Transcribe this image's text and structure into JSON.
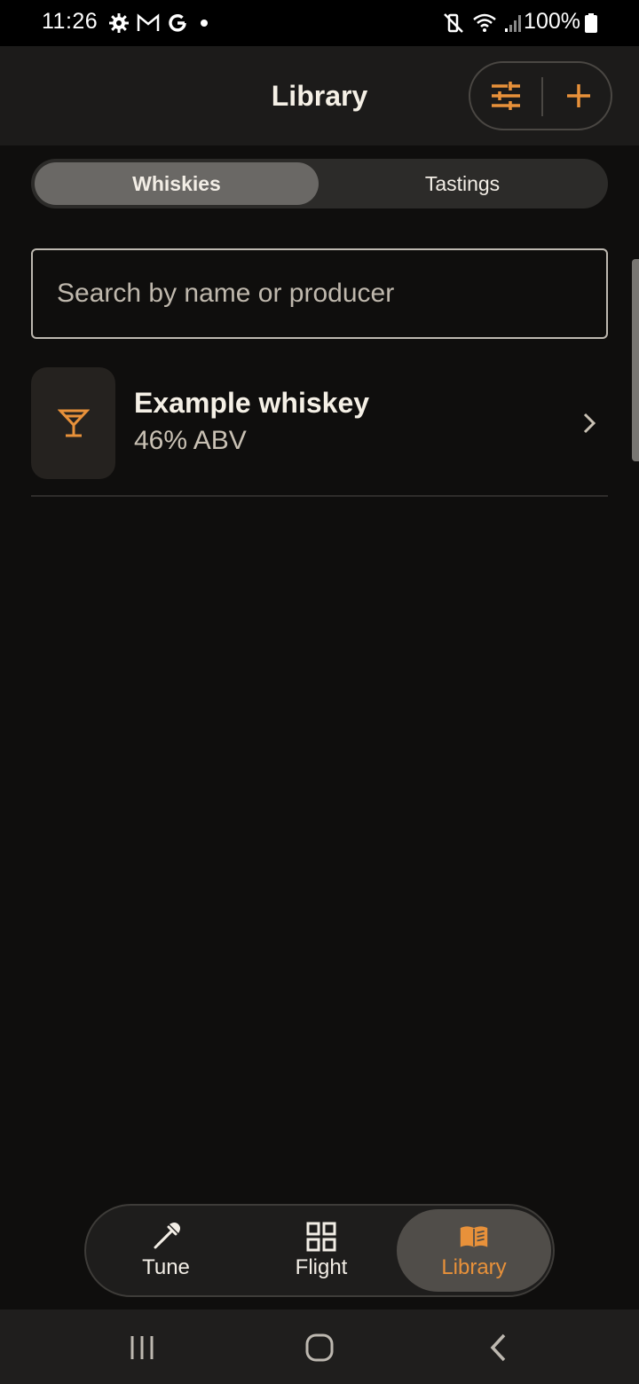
{
  "status_bar": {
    "time": "11:26",
    "battery": "100%",
    "left_icons": [
      "settings-icon",
      "gmail-icon",
      "google-icon",
      "dot-icon"
    ],
    "right_icons": [
      "mute-icon",
      "wifi-icon",
      "signal-icon",
      "battery-icon"
    ]
  },
  "header": {
    "title": "Library",
    "actions": [
      "filter-icon",
      "add-icon"
    ]
  },
  "tabs": [
    {
      "label": "Whiskies",
      "active": true
    },
    {
      "label": "Tastings",
      "active": false
    }
  ],
  "search": {
    "placeholder": "Search by name or producer",
    "value": ""
  },
  "items": [
    {
      "title": "Example whiskey",
      "subtitle": "46% ABV",
      "icon": "cocktail-icon"
    }
  ],
  "bottom_nav": [
    {
      "label": "Tune",
      "icon": "dropper-icon",
      "active": false
    },
    {
      "label": "Flight",
      "icon": "grid-icon",
      "active": false
    },
    {
      "label": "Library",
      "icon": "book-icon",
      "active": true
    }
  ],
  "colors": {
    "accent": "#e8913a",
    "background": "#0f0e0d",
    "surface": "#1c1b1a"
  }
}
